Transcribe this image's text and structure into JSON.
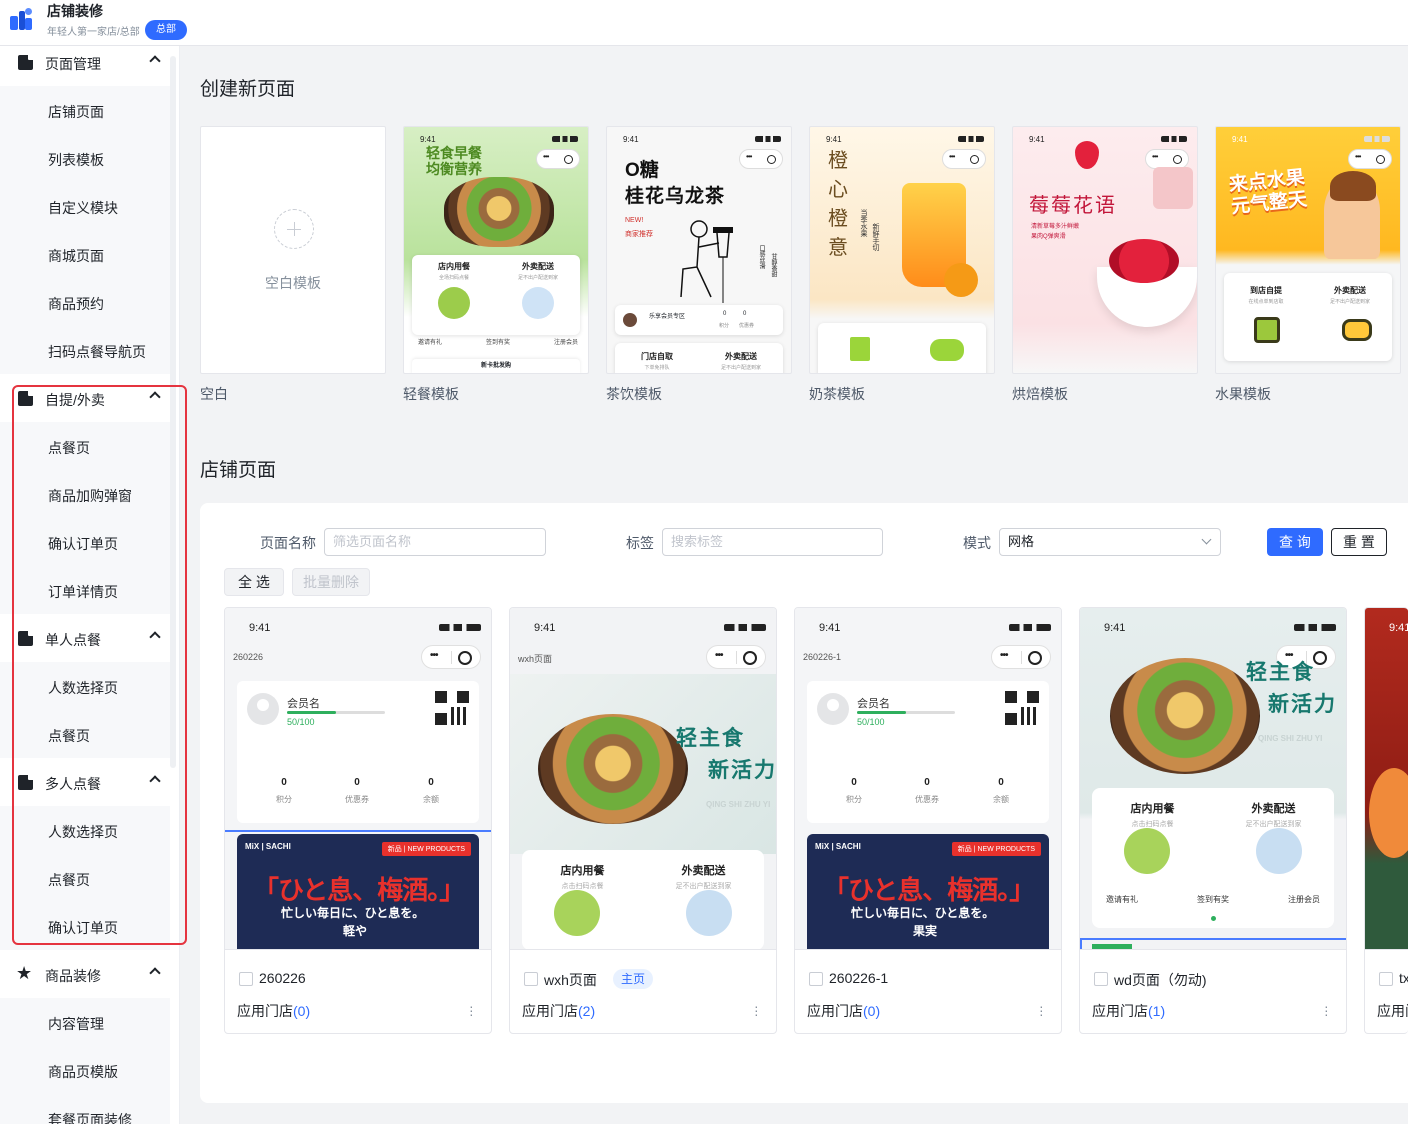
{
  "header": {
    "title": "店铺装修",
    "subtitle": "年轻人第一家店/总部",
    "badge": "总部"
  },
  "sidebar": {
    "groups": [
      {
        "label": "页面管理",
        "items": [
          "店铺页面",
          "列表模板",
          "自定义模块",
          "商城页面",
          "商品预约",
          "扫码点餐导航页"
        ]
      },
      {
        "label": "自提/外卖",
        "items": [
          "点餐页",
          "商品加购弹窗",
          "确认订单页",
          "订单详情页"
        ]
      },
      {
        "label": "单人点餐",
        "items": [
          "人数选择页",
          "点餐页"
        ]
      },
      {
        "label": "多人点餐",
        "items": [
          "人数选择页",
          "点餐页",
          "确认订单页"
        ]
      },
      {
        "label": "商品装修",
        "items": [
          "内容管理",
          "商品页模版",
          "套餐页面装修"
        ]
      }
    ]
  },
  "create": {
    "title": "创建新页面",
    "blank_text": "空白模板",
    "templates": [
      {
        "label": "空白"
      },
      {
        "label": "轻餐模板"
      },
      {
        "label": "茶饮模板"
      },
      {
        "label": "奶茶模板"
      },
      {
        "label": "烘焙模板"
      },
      {
        "label": "水果模板"
      }
    ],
    "t1": {
      "time": "9:41",
      "hero": "轻食早餐\n均衡营养",
      "left": "店内用餐",
      "left_sub": "全场扫码点餐",
      "right": "外卖配送",
      "right_sub": "足不出户配送到家",
      "links": [
        "邀请有礼",
        "签到有奖",
        "注册会员"
      ],
      "bottom": "新卡批发购"
    },
    "t2": {
      "time": "9:41",
      "h1": "O糖",
      "h2": "桂花乌龙茶",
      "new": "NEW!",
      "rec": "商家推荐",
      "side": "口感丝滑",
      "side2": "甘醇香甜",
      "member": "乐享会员专区",
      "v1": "0",
      "v2": "0",
      "l1": "积分",
      "l2": "优惠券",
      "left": "门店自取",
      "left_sub": "下单免排队",
      "right": "外卖配送",
      "right_sub": "足不出户配送到家"
    },
    "t3": {
      "time": "9:41",
      "hero": "橙\n心\n橙\n意",
      "side": "当季水果",
      "side2": "新鲜手切"
    },
    "t4": {
      "time": "9:41",
      "hero": "莓莓花语",
      "sub1": "清新草莓多汁鲜嫩",
      "sub2": "果肉Q弹爽滑"
    },
    "t5": {
      "time": "9:41",
      "hero": "来点水果\n元气整天",
      "left": "到店自提",
      "left_sub": "在线点单到店取",
      "right": "外卖配送",
      "right_sub": "足不出户配送到家"
    }
  },
  "shop": {
    "title": "店铺页面",
    "filters": {
      "name_label": "页面名称",
      "name_placeholder": "筛选页面名称",
      "tag_label": "标签",
      "tag_placeholder": "搜索标签",
      "mode_label": "模式",
      "mode_value": "网格"
    },
    "buttons": {
      "query": "查 询",
      "reset": "重 置",
      "select_all": "全 选",
      "batch_delete": "批量删除"
    },
    "cards": [
      {
        "time": "9:41",
        "page": "260226",
        "title": "260226",
        "apply": "应用门店",
        "count": "(0)"
      },
      {
        "time": "9:41",
        "page": "wxh页面",
        "title": "wxh页面",
        "tag": "主页",
        "apply": "应用门店",
        "count": "(2)"
      },
      {
        "time": "9:41",
        "page": "260226-1",
        "title": "260226-1",
        "apply": "应用门店",
        "count": "(0)"
      },
      {
        "time": "9:41",
        "page": "",
        "title": "wd页面（勿动)",
        "apply": "应用门店",
        "count": "(1)"
      },
      {
        "time": "9:41",
        "title": "tx",
        "apply": "应用门"
      }
    ],
    "member": {
      "name": "会员名",
      "points": "50/100",
      "v": "0",
      "l1": "积分",
      "l2": "优惠券",
      "l3": "余额",
      "progress": 0.5
    },
    "banner": {
      "brand": "MiX | SACHI",
      "tag": "新品 | NEW PRODUCTS",
      "jp": "「ひと息、梅酒。」",
      "jp2": "忙しい毎日に、ひと息を。",
      "jp3": "軽や",
      "jp4": "果実"
    },
    "food": {
      "t1": "轻主食",
      "t2": "新活力",
      "en": "QING SHI ZHU YI"
    },
    "dual": {
      "left": "店内用餐",
      "left_sub": "点击扫码点餐",
      "right": "外卖配送",
      "right_sub": "足不出户配送到家"
    },
    "links": [
      "邀请有礼",
      "签到有奖",
      "注册会员"
    ]
  },
  "colors": {
    "primary": "#2f6bff",
    "highlight": "#e5343f"
  }
}
